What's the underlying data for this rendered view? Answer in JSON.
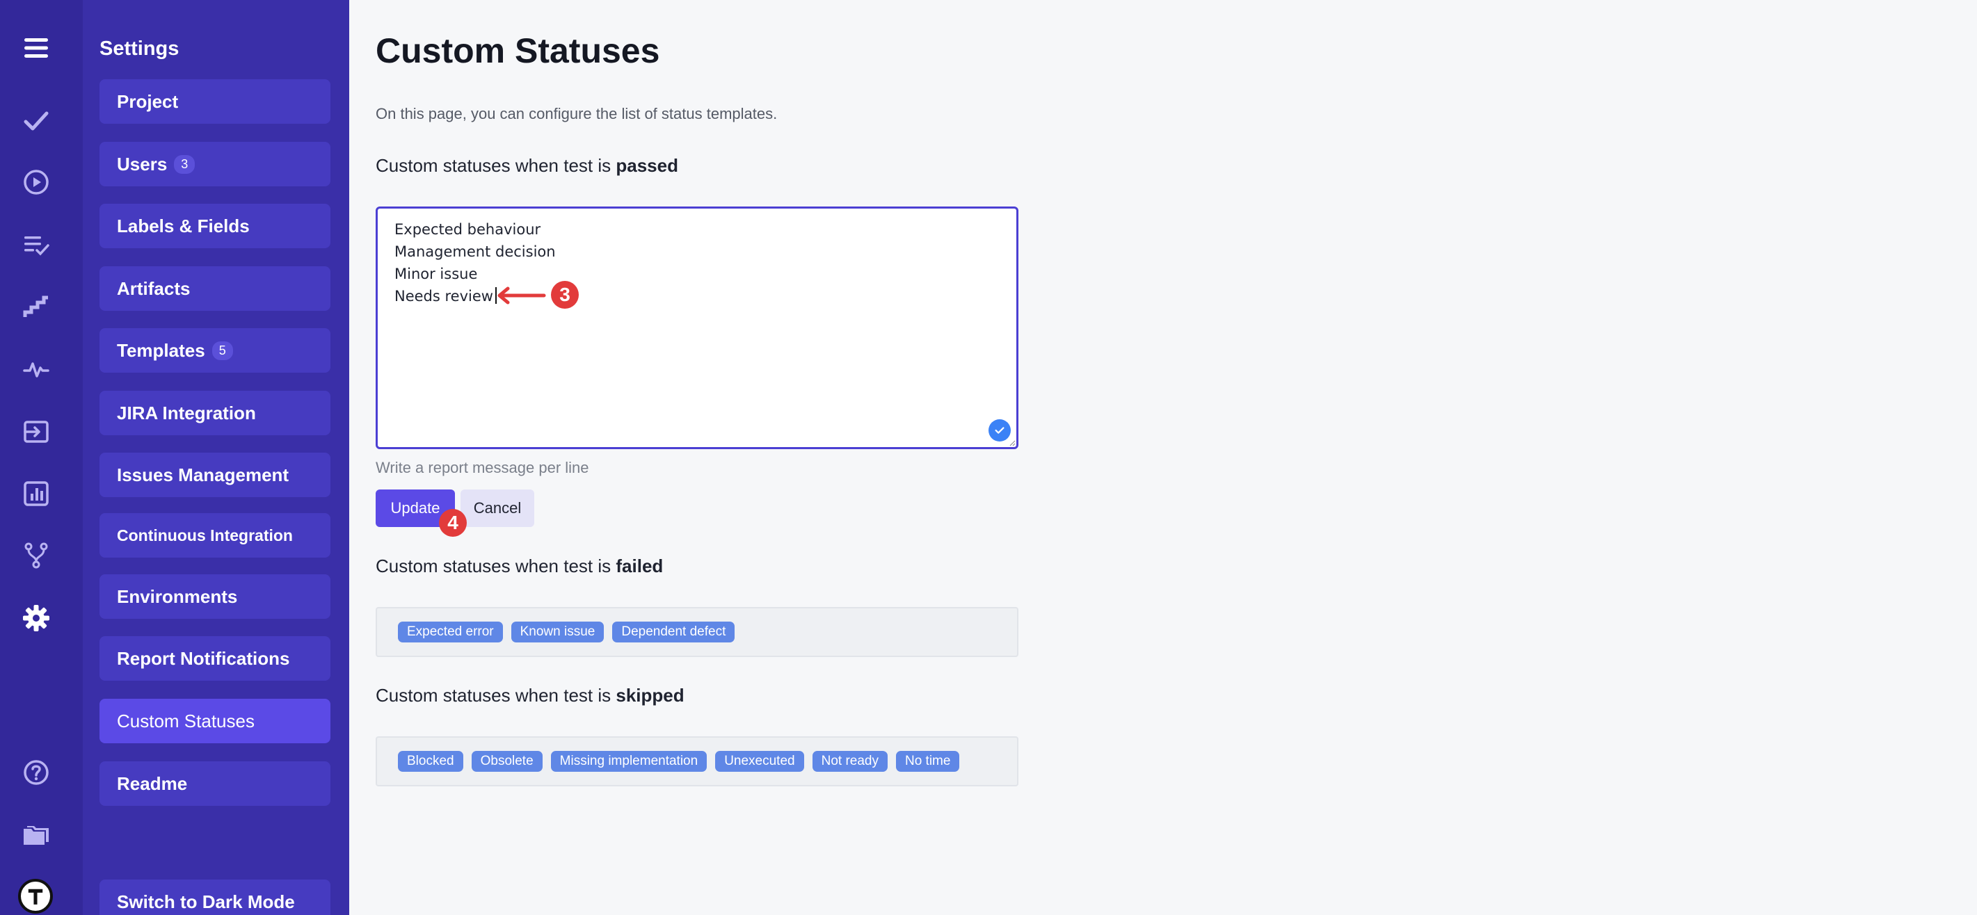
{
  "sidebar": {
    "title": "Settings",
    "items": [
      {
        "label": "Project",
        "badge": ""
      },
      {
        "label": "Users",
        "badge": "3"
      },
      {
        "label": "Labels & Fields",
        "badge": ""
      },
      {
        "label": "Artifacts",
        "badge": ""
      },
      {
        "label": "Templates",
        "badge": "5"
      },
      {
        "label": "JIRA Integration",
        "badge": ""
      },
      {
        "label": "Issues Management",
        "badge": ""
      },
      {
        "label": "Continuous Integration",
        "badge": ""
      },
      {
        "label": "Environments",
        "badge": ""
      },
      {
        "label": "Report Notifications",
        "badge": ""
      },
      {
        "label": "Custom Statuses",
        "badge": ""
      },
      {
        "label": "Readme",
        "badge": ""
      }
    ],
    "active_item": "Custom Statuses",
    "dark_mode_label": "Switch to Dark Mode"
  },
  "rail_icons": [
    "menu-icon",
    "check-icon",
    "play-icon",
    "list-check-icon",
    "stairs-icon",
    "pulse-icon",
    "import-icon",
    "chart-icon",
    "branch-icon",
    "gear-icon",
    "help-icon",
    "folder-icon",
    "logo-icon"
  ],
  "main": {
    "title": "Custom Statuses",
    "description": "On this page, you can configure the list of status templates.",
    "passed": {
      "prefix": "Custom statuses when test is",
      "status": "passed",
      "lines": [
        "Expected behaviour",
        "Management decision",
        "Minor issue",
        "Needs review"
      ],
      "hint": "Write a report message per line",
      "update_label": "Update",
      "cancel_label": "Cancel"
    },
    "failed": {
      "prefix": "Custom statuses when test is",
      "status": "failed",
      "tags": [
        "Expected error",
        "Known issue",
        "Dependent defect"
      ]
    },
    "skipped": {
      "prefix": "Custom statuses when test is",
      "status": "skipped",
      "tags": [
        "Blocked",
        "Obsolete",
        "Missing implementation",
        "Unexecuted",
        "Not ready",
        "No time"
      ]
    }
  },
  "annotations": {
    "marker_a": "3",
    "marker_b": "4"
  },
  "colors": {
    "rail": "#33289a",
    "sidebar": "#3a2fa8",
    "accent": "#5b4ae6",
    "tag": "#5f87e6",
    "marker": "#e23b3b"
  }
}
